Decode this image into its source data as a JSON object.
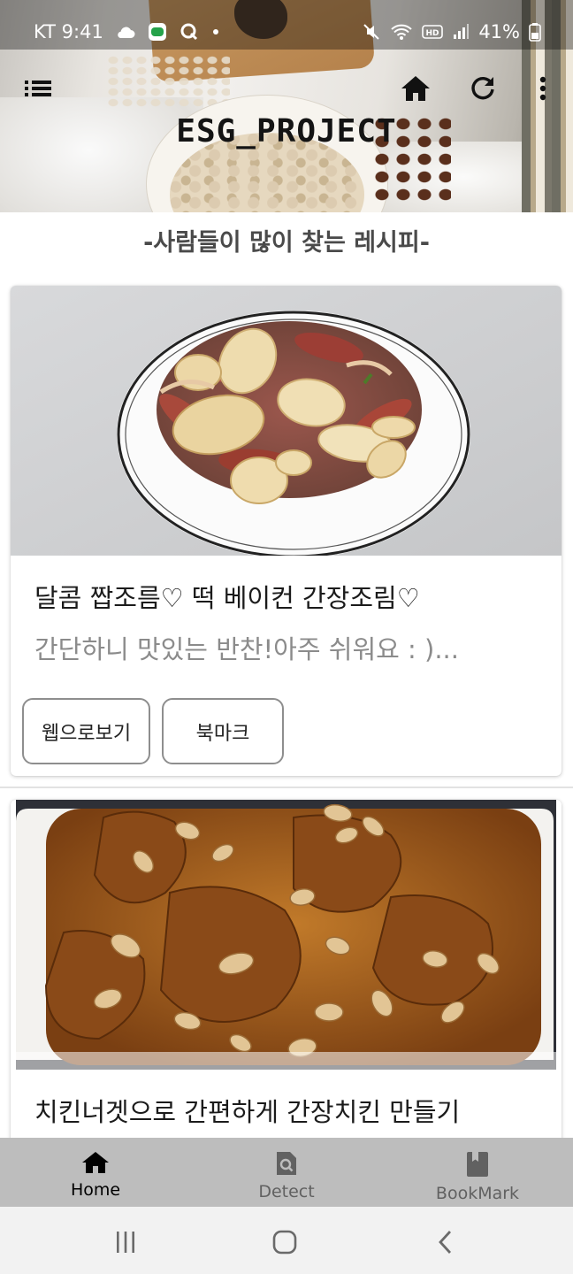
{
  "status_bar": {
    "carrier_time": "KT 9:41",
    "battery": "41%",
    "left_icons": [
      "cloud-icon",
      "line-app-icon",
      "q-app-icon",
      "dot-icon"
    ],
    "right_icons": [
      "mute-icon",
      "wifi-icon",
      "hd-icon",
      "signal-icon",
      "battery-icon"
    ]
  },
  "app_bar": {
    "title": "ESG_PROJECT",
    "icons": [
      "list-menu-icon",
      "home-icon",
      "refresh-icon",
      "more-vert-icon"
    ]
  },
  "section_heading": "-사람들이 많이 찾는 레시피-",
  "recipes": [
    {
      "title": "달콤 짭조름♡ 떡 베이컨 간장조림♡",
      "description": "간단하니 맛있는 반찬!아주 쉬워요 : )...",
      "image_icon": "tteok-bacon-dish-image",
      "buttons": {
        "web_view": "웹으로보기",
        "bookmark": "북마크"
      }
    },
    {
      "title": "치킨너겟으로 간편하게 간장치킨 만들기",
      "image_icon": "soy-chicken-dish-image"
    }
  ],
  "bottom_nav": {
    "items": [
      {
        "label": "Home",
        "icon": "home-icon",
        "active": true
      },
      {
        "label": "Detect",
        "icon": "detect-search-icon",
        "active": false
      },
      {
        "label": "BookMark",
        "icon": "bookmark-book-icon",
        "active": false
      }
    ]
  },
  "system_nav": [
    "recent-apps-icon",
    "home-circle-icon",
    "back-icon"
  ],
  "colors": {
    "nav_background": "#bdbdbd",
    "card_title": "#1b1b1b",
    "card_description": "#8b8b8b",
    "section_heading": "#4a4a4a"
  }
}
